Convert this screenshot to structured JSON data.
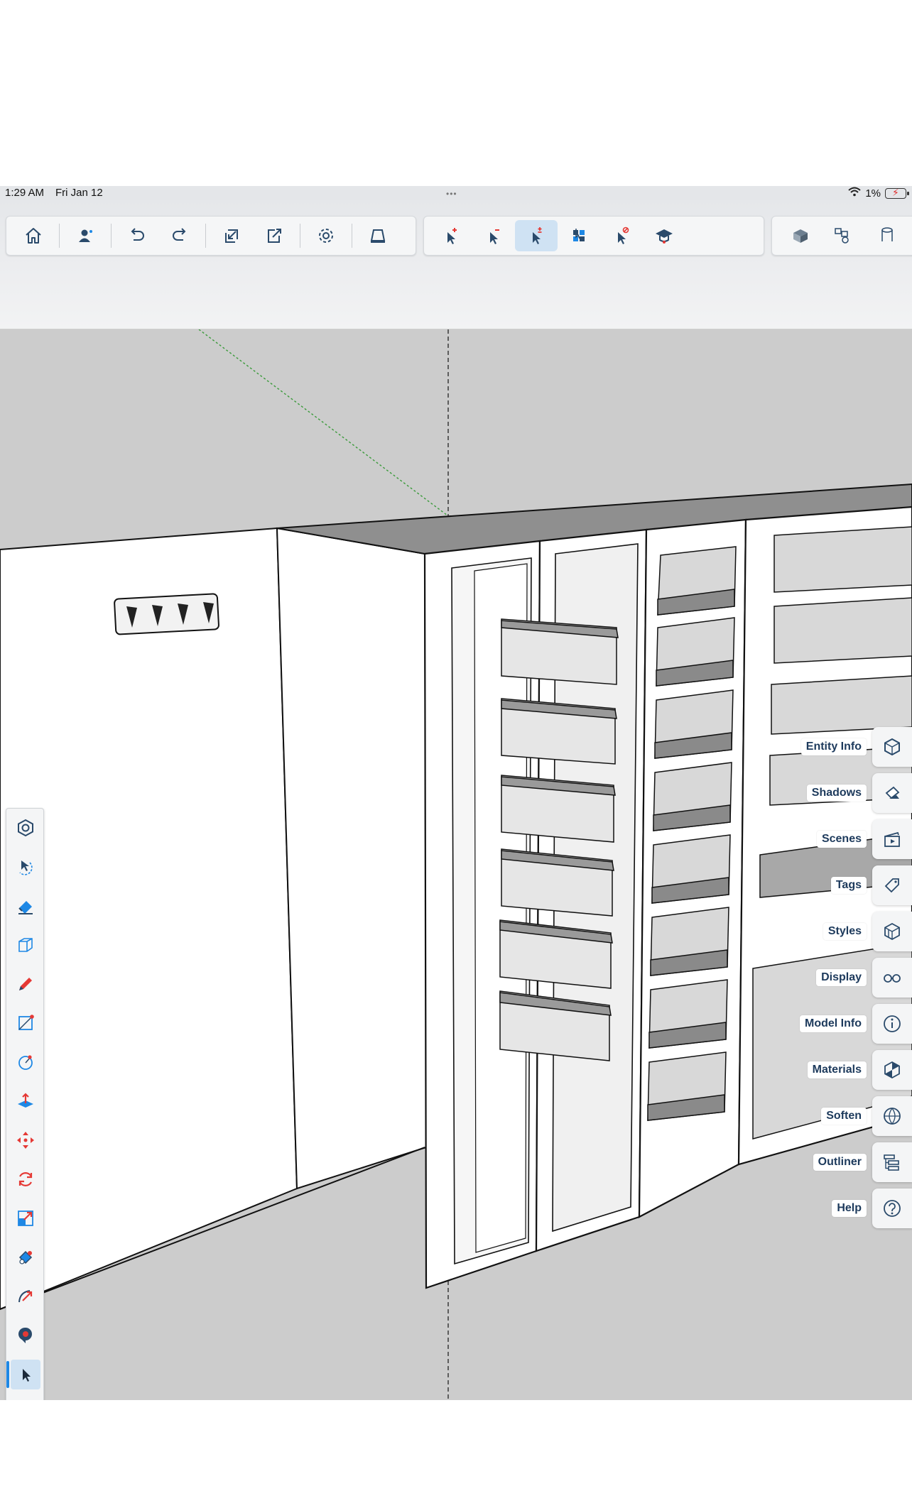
{
  "status_bar": {
    "time": "1:29 AM",
    "date": "Fri Jan 12",
    "battery": "1%",
    "grabber": "•••"
  },
  "toolbar_left": [
    {
      "name": "home-icon",
      "label": "Home"
    },
    {
      "name": "account-icon",
      "label": "Account"
    },
    {
      "name": "undo-icon",
      "label": "Undo"
    },
    {
      "name": "redo-icon",
      "label": "Redo"
    },
    {
      "name": "import-icon",
      "label": "Import"
    },
    {
      "name": "export-icon",
      "label": "Export"
    },
    {
      "name": "settings-icon",
      "label": "Settings"
    },
    {
      "name": "ar-icon",
      "label": "AR"
    }
  ],
  "toolbar_select": [
    {
      "name": "select-add-icon",
      "label": "Add to selection"
    },
    {
      "name": "select-subtract-icon",
      "label": "Subtract from selection"
    },
    {
      "name": "select-toggle-icon",
      "label": "Toggle selection",
      "selected": true
    },
    {
      "name": "select-all-icon",
      "label": "Select all"
    },
    {
      "name": "select-none-icon",
      "label": "Select none"
    },
    {
      "name": "learn-icon",
      "label": "Learn"
    }
  ],
  "toolbar_right": [
    {
      "name": "view-box-icon",
      "label": "View"
    },
    {
      "name": "components-icon",
      "label": "Components"
    },
    {
      "name": "cylinder-icon",
      "label": "More"
    }
  ],
  "tools": [
    {
      "name": "orbit-view-icon"
    },
    {
      "name": "select-lasso-icon"
    },
    {
      "name": "eraser-icon"
    },
    {
      "name": "box-solid-icon"
    },
    {
      "name": "pencil-icon"
    },
    {
      "name": "rectangle-icon"
    },
    {
      "name": "circle-icon"
    },
    {
      "name": "push-pull-icon"
    },
    {
      "name": "move-icon"
    },
    {
      "name": "rotate-icon"
    },
    {
      "name": "scale-icon"
    },
    {
      "name": "paint-bucket-icon"
    },
    {
      "name": "follow-me-icon"
    },
    {
      "name": "tape-measure-icon"
    },
    {
      "name": "select-tool-icon",
      "selected": true
    },
    {
      "name": "more-tools-icon",
      "text": "···"
    }
  ],
  "panels": [
    {
      "label": "Entity Info",
      "icon": "entity-info-icon"
    },
    {
      "label": "Shadows",
      "icon": "shadows-icon"
    },
    {
      "label": "Scenes",
      "icon": "scenes-icon"
    },
    {
      "label": "Tags",
      "icon": "tags-icon"
    },
    {
      "label": "Styles",
      "icon": "styles-icon"
    },
    {
      "label": "Display",
      "icon": "display-icon"
    },
    {
      "label": "Model Info",
      "icon": "model-info-icon"
    },
    {
      "label": "Materials",
      "icon": "materials-icon"
    },
    {
      "label": "Soften",
      "icon": "soften-icon"
    },
    {
      "label": "Outliner",
      "icon": "outliner-icon"
    },
    {
      "label": "Help",
      "icon": "help-icon"
    }
  ],
  "colors": {
    "accent": "#1e88e5",
    "icon_blue": "#2a4a6b",
    "tool_red": "#e53935",
    "selected_bg": "#cfe2f3",
    "ground": "#cfcfcf"
  }
}
